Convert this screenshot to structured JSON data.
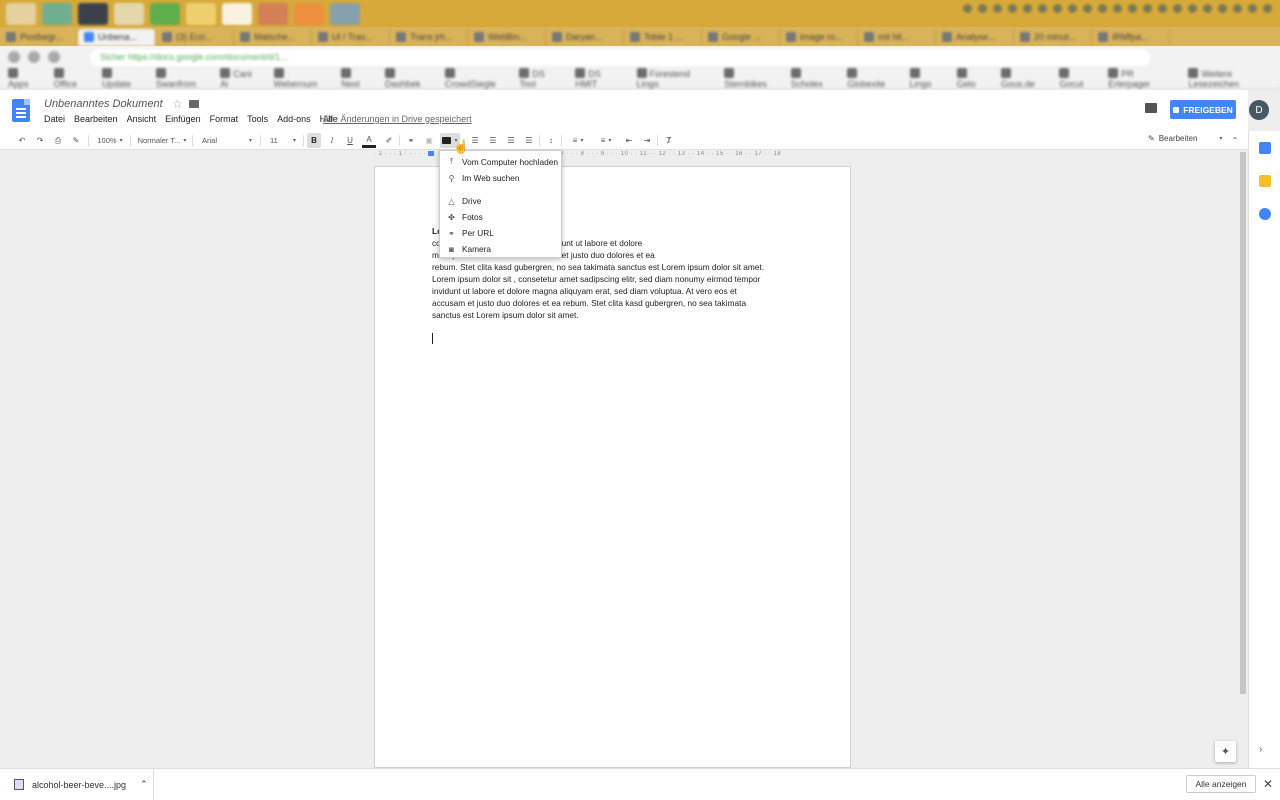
{
  "taskbar": {
    "icon_colors": [
      "#e7d8b0",
      "#5fb0a0",
      "#213050",
      "#e8e0c0",
      "#4caf50",
      "#f2d777",
      "#ffffff",
      "#d4785c",
      "#f28b40",
      "#7aa0c0"
    ]
  },
  "browser": {
    "tabs": [
      {
        "label": "Postbegr..."
      },
      {
        "label": "Unbena..."
      },
      {
        "label": "(3) Erzi..."
      },
      {
        "label": "Malsche..."
      },
      {
        "label": "Ul / Trav..."
      },
      {
        "label": "Trans jrh..."
      },
      {
        "label": "WebBin..."
      },
      {
        "label": "Daryan..."
      },
      {
        "label": "Toble 1 ..."
      },
      {
        "label": "Google ..."
      },
      {
        "label": "image ro..."
      },
      {
        "label": "mit hil..."
      },
      {
        "label": "Analyse..."
      },
      {
        "label": "20 minut..."
      },
      {
        "label": "IRMfpa..."
      }
    ],
    "address": "Sicher  https://docs.google.com/document/d/1...",
    "bookmarks": [
      "Apps",
      "Office",
      "Update",
      "Swanfrom",
      "Cani Ai",
      "Webernum",
      "Next",
      "Dashbek",
      "CrowdSiegle",
      "DS Tool",
      "DS HMIT",
      "Forestend Lingo",
      "Sternbikes",
      "Scholex",
      "Globexite",
      "Lingo",
      "Gelo",
      "Gous.de",
      "Gocut",
      "PR Erlerpager",
      "Weitere Lesezeichen"
    ]
  },
  "docs": {
    "title": "Unbenanntes Dokument",
    "menu": [
      "Datei",
      "Bearbeiten",
      "Ansicht",
      "Einfügen",
      "Format",
      "Tools",
      "Add-ons",
      "Hilfe"
    ],
    "saved_status": "Alle Änderungen in Drive gespeichert",
    "share_label": "FREIGEBEN",
    "avatar_initial": "D",
    "accent_color": "#4285f4"
  },
  "toolbar": {
    "zoom": "100%",
    "style": "Normaler T...",
    "font": "Arial",
    "font_size": "11",
    "bold": "B",
    "italic": "I",
    "underline": "U",
    "text_color_glyph": "A",
    "edit_mode": "Bearbeiten"
  },
  "ruler": {
    "text": "· 2 · · · 1 · · · · · · · · · · · · 2 · · · 3 · · · 4 · · · 5 · · · 6 · · · 7 · · · 8 · · · 9 · · · 10 · · 11 · · 12 · · 13 · · 14 · · 15 · · 16 · · 17 · · 18"
  },
  "document": {
    "first_line_bold": "Lo",
    "lines": [
      "co                                                am nonumy eirmod tempor invidunt ut labore et dolore",
      "m                                                 oluptua. At vero eos et accusam et justo duo dolores et ea",
      "rebum. Stet clita kasd gubergren, no sea takimata sanctus est Lorem ipsum dolor sit amet.",
      "Lorem ipsum dolor sit , consetetur amet sadipscing elitr, sed diam nonumy eirmod tempor",
      "invidunt ut labore et dolore magna aliquyam erat, sed diam voluptua. At vero eos et",
      "accusam et justo duo dolores et ea rebum. Stet clita kasd gubergren, no sea takimata",
      "sanctus est Lorem ipsum dolor sit amet."
    ]
  },
  "image_menu": {
    "items": [
      {
        "label": "Vom Computer hochladen",
        "icon": "upload-icon"
      },
      {
        "label": "Im Web suchen",
        "icon": "search-icon"
      },
      {
        "label": "Drive",
        "icon": "drive-icon"
      },
      {
        "label": "Fotos",
        "icon": "photos-icon"
      },
      {
        "label": "Per URL",
        "icon": "link-icon"
      },
      {
        "label": "Kamera",
        "icon": "camera-icon"
      }
    ]
  },
  "download_bar": {
    "file_name": "alcohol-beer-beve....jpg",
    "show_all": "Alle anzeigen"
  }
}
